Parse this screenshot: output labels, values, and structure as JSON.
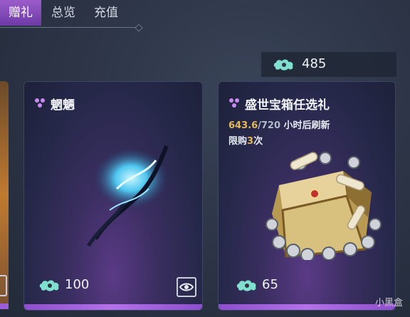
{
  "tabs": [
    {
      "label": "赠礼",
      "active": true
    },
    {
      "label": "总览",
      "active": false
    },
    {
      "label": "充值",
      "active": false
    }
  ],
  "currency": {
    "icon": "cloud-currency-icon",
    "amount": "485"
  },
  "cards": [
    {
      "title": "魍魉",
      "price": "100",
      "icons": [
        "purple-triangle-icon",
        "cloud-currency-icon",
        "eye-icon"
      ]
    },
    {
      "title": "盛世宝箱任选礼",
      "refresh_current": "643.6",
      "refresh_sep_total": "/720",
      "refresh_suffix": " 小时后刷新",
      "limit_prefix": "限购",
      "limit_count": "3",
      "limit_suffix": "次",
      "price": "65",
      "icons": [
        "purple-triangle-icon",
        "cloud-currency-icon",
        "treasure-chest-icon"
      ]
    }
  ],
  "watermark": "小黑盒",
  "colors": {
    "accent": "#8d4ed0",
    "gold": "#e2b85a",
    "currency": "#7fe0d0"
  }
}
